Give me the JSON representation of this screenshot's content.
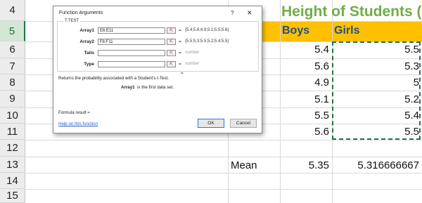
{
  "sheet": {
    "rows": [
      "4",
      "5",
      "6",
      "7",
      "8",
      "9",
      "10",
      "11",
      "12",
      "13",
      "14",
      "15"
    ],
    "title": "Height of Students (I",
    "boys_header": "Boys",
    "girls_header": "Girls",
    "boys": [
      "5.4",
      "5.6",
      "4.9",
      "5.1",
      "5.5",
      "5.6"
    ],
    "girls": [
      "5.5",
      "5.3",
      "5",
      "5.2",
      "5.4",
      "5.5"
    ],
    "mean_label": "Mean",
    "mean_boys": "5.35",
    "mean_girls": "5.316666667"
  },
  "dialog": {
    "title": "Function Arguments",
    "help_glyph": "?",
    "close_glyph": "✕",
    "function_name": "T.TEST",
    "args": [
      {
        "label": "Array1",
        "value": "E6:E11",
        "result": "{5.4;5.6;4.9;5.1;5.5;5.6}"
      },
      {
        "label": "Array2",
        "value": "F6:F11",
        "result": "{5.5;5.3;5.5;5.2;5.4;5.5}"
      },
      {
        "label": "Tails",
        "value": "",
        "result": "number"
      },
      {
        "label": "Type",
        "value": "",
        "result": "number"
      }
    ],
    "equals": "=",
    "description": "Returns the probability associated with a Student's t-Test.",
    "arg_name": "Array1",
    "arg_description": "is the first data set.",
    "formula_result": "Formula result =",
    "help_link": "Help on this function",
    "ok": "OK",
    "cancel": "Cancel"
  }
}
